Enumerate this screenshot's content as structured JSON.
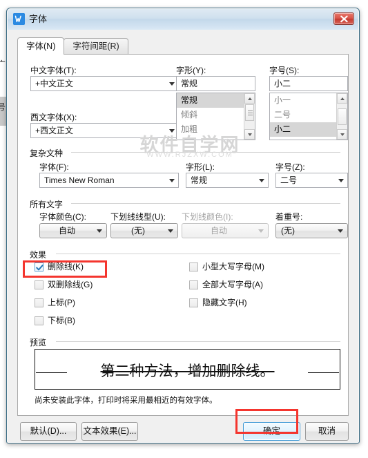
{
  "window": {
    "title": "字体",
    "icon": "wps-writer-icon",
    "close_label": "×"
  },
  "tabs": [
    {
      "label": "字体(N)",
      "active": true
    },
    {
      "label": "字符间距(R)",
      "active": false
    }
  ],
  "latin_chinese": {
    "chinese_font": {
      "label": "中文字体(T):",
      "value": "+中文正文"
    },
    "western_font": {
      "label": "西文字体(X):",
      "value": "+西文正文"
    },
    "font_style": {
      "label": "字形(Y):",
      "value": "常规",
      "options": [
        "常规",
        "倾斜",
        "加粗"
      ],
      "selected_index": 0
    },
    "font_size": {
      "label": "字号(S):",
      "value": "小二",
      "options": [
        "小一",
        "二号",
        "小二"
      ],
      "selected_index": 2
    }
  },
  "complex_script": {
    "caption": "复杂文种",
    "font": {
      "label": "字体(F):",
      "value": "Times New Roman"
    },
    "style": {
      "label": "字形(L):",
      "value": "常规"
    },
    "size": {
      "label": "字号(Z):",
      "value": "二号"
    }
  },
  "all_text": {
    "caption": "所有文字",
    "font_color": {
      "label": "字体颜色(C):",
      "value": "自动",
      "disabled": false
    },
    "underline_style": {
      "label": "下划线线型(U):",
      "value": "(无)",
      "disabled": false
    },
    "underline_color": {
      "label": "下划线颜色(I):",
      "value": "自动",
      "disabled": true
    },
    "emphasis_mark": {
      "label": "着重号:",
      "value": "(无)",
      "disabled": false
    }
  },
  "effects": {
    "caption": "效果",
    "left": [
      {
        "label": "删除线(K)",
        "checked": true
      },
      {
        "label": "双删除线(G)",
        "checked": false
      },
      {
        "label": "上标(P)",
        "checked": false
      },
      {
        "label": "下标(B)",
        "checked": false
      }
    ],
    "right": [
      {
        "label": "小型大写字母(M)",
        "checked": false
      },
      {
        "label": "全部大写字母(A)",
        "checked": false
      },
      {
        "label": "隐藏文字(H)",
        "checked": false
      }
    ]
  },
  "preview": {
    "caption": "预览",
    "sample_text": "第二种方法，增加删除线。",
    "note": "尚未安装此字体，打印时将采用最相近的有效字体。"
  },
  "footer": {
    "default_button": "默认(D)...",
    "text_effects_button": "文本效果(E)...",
    "ok_button": "确定",
    "cancel_button": "取消"
  },
  "watermark": {
    "line1": "软件自学网",
    "line2": "WWW.RJZXW.COM"
  },
  "colors": {
    "accent": "#3f9ad6",
    "annotation": "#f4352e",
    "dialog_bg": "#f0f0f0",
    "panel_bg": "#ffffff",
    "selection": "#d6d6d6"
  }
}
